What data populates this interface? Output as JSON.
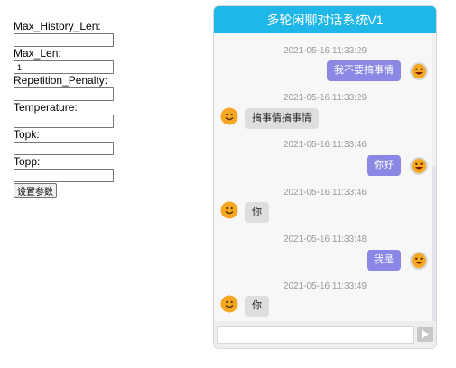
{
  "settings": {
    "fields": [
      {
        "label": "Max_History_Len:",
        "value": ""
      },
      {
        "label": "Max_Len:",
        "value": "1"
      },
      {
        "label": "Repetition_Penalty:",
        "value": ""
      },
      {
        "label": "Temperature:",
        "value": ""
      },
      {
        "label": "Topk:",
        "value": ""
      },
      {
        "label": "Topp:",
        "value": ""
      }
    ],
    "submit_label": "设置参数"
  },
  "chat": {
    "title": "多轮闲聊对话系统V1",
    "messages": [
      {
        "time": "2021-05-16 11:33:29",
        "side": "right",
        "text": "我不要搞事情"
      },
      {
        "time": "2021-05-16 11:33:29",
        "side": "left",
        "text": "搞事情搞事情"
      },
      {
        "time": "2021-05-16 11:33:46",
        "side": "right",
        "text": "你好"
      },
      {
        "time": "2021-05-16 11:33:46",
        "side": "left",
        "text": "你"
      },
      {
        "time": "2021-05-16 11:33:48",
        "side": "right",
        "text": "我是"
      },
      {
        "time": "2021-05-16 11:33:49",
        "side": "left",
        "text": "你"
      }
    ],
    "input_value": "",
    "colors": {
      "header": "#1fb7e8",
      "user_bubble": "#8b87e4",
      "bot_bubble": "#dedede",
      "timestamp": "#9a9a9a"
    }
  }
}
